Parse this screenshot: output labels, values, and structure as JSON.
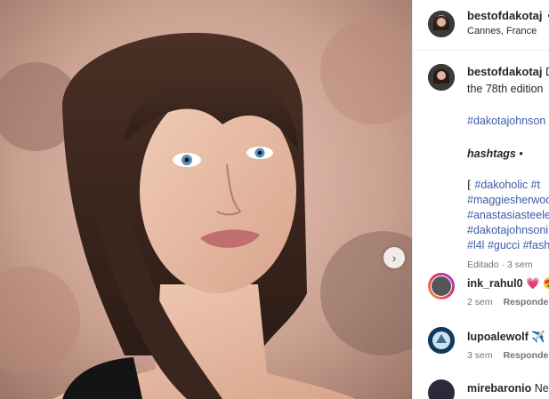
{
  "post": {
    "username": "bestofdakotaj",
    "location": "Cannes, France",
    "follow_dot": "•"
  },
  "caption": {
    "username": "bestofdakotaj",
    "text_line1": "Da",
    "text_line2": "the 78th edition",
    "hashtag_primary": "#dakotajohnson",
    "hashtags_title": "hashtags",
    "hashtags_dot": "•",
    "tags_line1_prefix": "⁅",
    "tags": [
      [
        "#dakoholic",
        "#t"
      ],
      [
        "#maggiesherwoo"
      ],
      [
        "#anastasiasteele"
      ],
      [
        "#dakotajohnsoni"
      ],
      [
        "#l4l",
        "#gucci",
        "#fash"
      ]
    ],
    "edited": "Editado",
    "age": "3 sem"
  },
  "comments": [
    {
      "username": "ink_rahul0",
      "emoji": "💗 😍",
      "age": "2 sem",
      "reply": "Responder"
    },
    {
      "username": "lupoalewolf",
      "emoji": "✈️ 😊",
      "age": "3 sem",
      "reply": "Responder"
    },
    {
      "username": "mirebaronio",
      "text": "Nes"
    }
  ],
  "media": {
    "next_icon": "chevron-right-icon"
  }
}
